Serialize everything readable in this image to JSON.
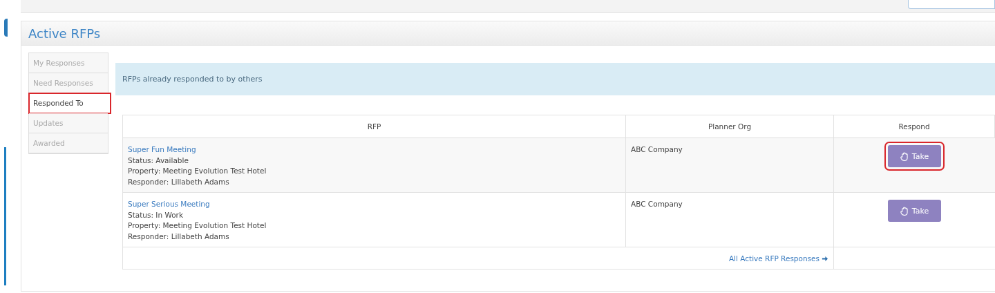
{
  "panel": {
    "title": "Active RFPs"
  },
  "tabs": [
    {
      "label": "My Responses",
      "selected": false,
      "highlighted": false
    },
    {
      "label": "Need Responses",
      "selected": false,
      "highlighted": false
    },
    {
      "label": "Responded To",
      "selected": true,
      "highlighted": true
    },
    {
      "label": "Updates",
      "selected": false,
      "highlighted": false
    },
    {
      "label": "Awarded",
      "selected": false,
      "highlighted": false
    }
  ],
  "info_bar": {
    "text": "RFPs already responded to by others"
  },
  "table": {
    "columns": [
      "RFP",
      "Planner Org",
      "Respond"
    ],
    "rows": [
      {
        "title": "Super Fun Meeting",
        "details": [
          "Status: Available",
          "Property: Meeting Evolution Test Hotel",
          "Responder: Lillabeth Adams"
        ],
        "planner_org": "ABC Company",
        "button": "Take",
        "highlighted": true
      },
      {
        "title": "Super Serious Meeting",
        "details": [
          "Status: In Work",
          "Property: Meeting Evolution Test Hotel",
          "Responder: Lillabeth Adams"
        ],
        "planner_org": "ABC Company",
        "button": "Take",
        "highlighted": false
      }
    ],
    "footer_link": "All Active RFP Responses"
  }
}
